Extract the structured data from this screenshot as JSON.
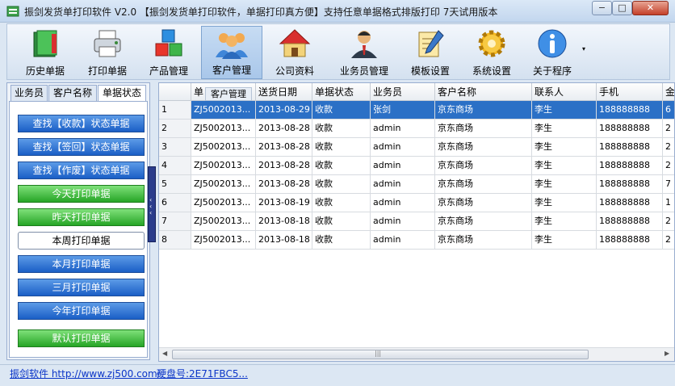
{
  "window": {
    "title": "振剑发货单打印软件  V2.0  【振剑发货单打印软件，单据打印真方便】支持任意单据格式排版打印      7天试用版本",
    "min_label": "−",
    "max_label": "□",
    "close_label": "✕"
  },
  "toolbar": {
    "items": [
      {
        "label": "历史单据",
        "icon": "history-book-icon"
      },
      {
        "label": "打印单据",
        "icon": "printer-icon"
      },
      {
        "label": "产品管理",
        "icon": "product-cubes-icon"
      },
      {
        "label": "客户管理",
        "icon": "customers-icon"
      },
      {
        "label": "公司资料",
        "icon": "company-house-icon"
      },
      {
        "label": "业务员管理",
        "icon": "salesman-icon"
      },
      {
        "label": "模板设置",
        "icon": "template-notepad-icon"
      },
      {
        "label": "系统设置",
        "icon": "gear-icon"
      },
      {
        "label": "关于程序",
        "icon": "info-icon"
      }
    ],
    "more_glyph": "▾",
    "active_index": 3
  },
  "left_panel": {
    "tabs": [
      "业务员",
      "客户名称",
      "单据状态"
    ],
    "active_tab": 2,
    "buttons": [
      {
        "label": "查找【收款】状态单据",
        "style": "blue"
      },
      {
        "label": "查找【签回】状态单据",
        "style": "blue"
      },
      {
        "label": "查找【作废】状态单据",
        "style": "blue"
      },
      {
        "label": "今天打印单据",
        "style": "green"
      },
      {
        "label": "昨天打印单据",
        "style": "green"
      },
      {
        "label": "本周打印单据",
        "style": "white"
      },
      {
        "label": "本月打印单据",
        "style": "blue"
      },
      {
        "label": "三月打印单据",
        "style": "blue"
      },
      {
        "label": "今年打印单据",
        "style": "blue"
      },
      {
        "label": "默认打印单据",
        "style": "green"
      }
    ],
    "splitter_glyphs": [
      "‹",
      "‹",
      "‹"
    ]
  },
  "grid": {
    "tooltip": "客户管理",
    "columns": [
      "",
      "单",
      "送货日期",
      "单据状态",
      "业务员",
      "客户名称",
      "联系人",
      "手机",
      "金"
    ],
    "selected_row": 0,
    "rows": [
      {
        "num": "1",
        "cells": [
          "ZJ5002013...",
          "2013-08-29",
          "收款",
          "张剑",
          "京东商场",
          "李生",
          "188888888",
          "6"
        ]
      },
      {
        "num": "2",
        "cells": [
          "ZJ5002013...",
          "2013-08-28",
          "收款",
          "admin",
          "京东商场",
          "李生",
          "188888888",
          "2"
        ]
      },
      {
        "num": "3",
        "cells": [
          "ZJ5002013...",
          "2013-08-28",
          "收款",
          "admin",
          "京东商场",
          "李生",
          "188888888",
          "2"
        ]
      },
      {
        "num": "4",
        "cells": [
          "ZJ5002013...",
          "2013-08-28",
          "收款",
          "admin",
          "京东商场",
          "李生",
          "188888888",
          "2"
        ]
      },
      {
        "num": "5",
        "cells": [
          "ZJ5002013...",
          "2013-08-28",
          "收款",
          "admin",
          "京东商场",
          "李生",
          "188888888",
          "7"
        ]
      },
      {
        "num": "6",
        "cells": [
          "ZJ5002013...",
          "2013-08-19",
          "收款",
          "admin",
          "京东商场",
          "李生",
          "188888888",
          "1"
        ]
      },
      {
        "num": "7",
        "cells": [
          "ZJ5002013...",
          "2013-08-18",
          "收款",
          "admin",
          "京东商场",
          "李生",
          "188888888",
          "2"
        ]
      },
      {
        "num": "8",
        "cells": [
          "ZJ5002013...",
          "2013-08-18",
          "收款",
          "admin",
          "京东商场",
          "李生",
          "188888888",
          "2"
        ]
      }
    ],
    "scroll_left": "◀",
    "scroll_right": "▶",
    "scroll_grip": "|||"
  },
  "status": {
    "website": "振剑软件 http://www.zj500.com/",
    "disk": "硬盘号:2E71FBC5..."
  }
}
